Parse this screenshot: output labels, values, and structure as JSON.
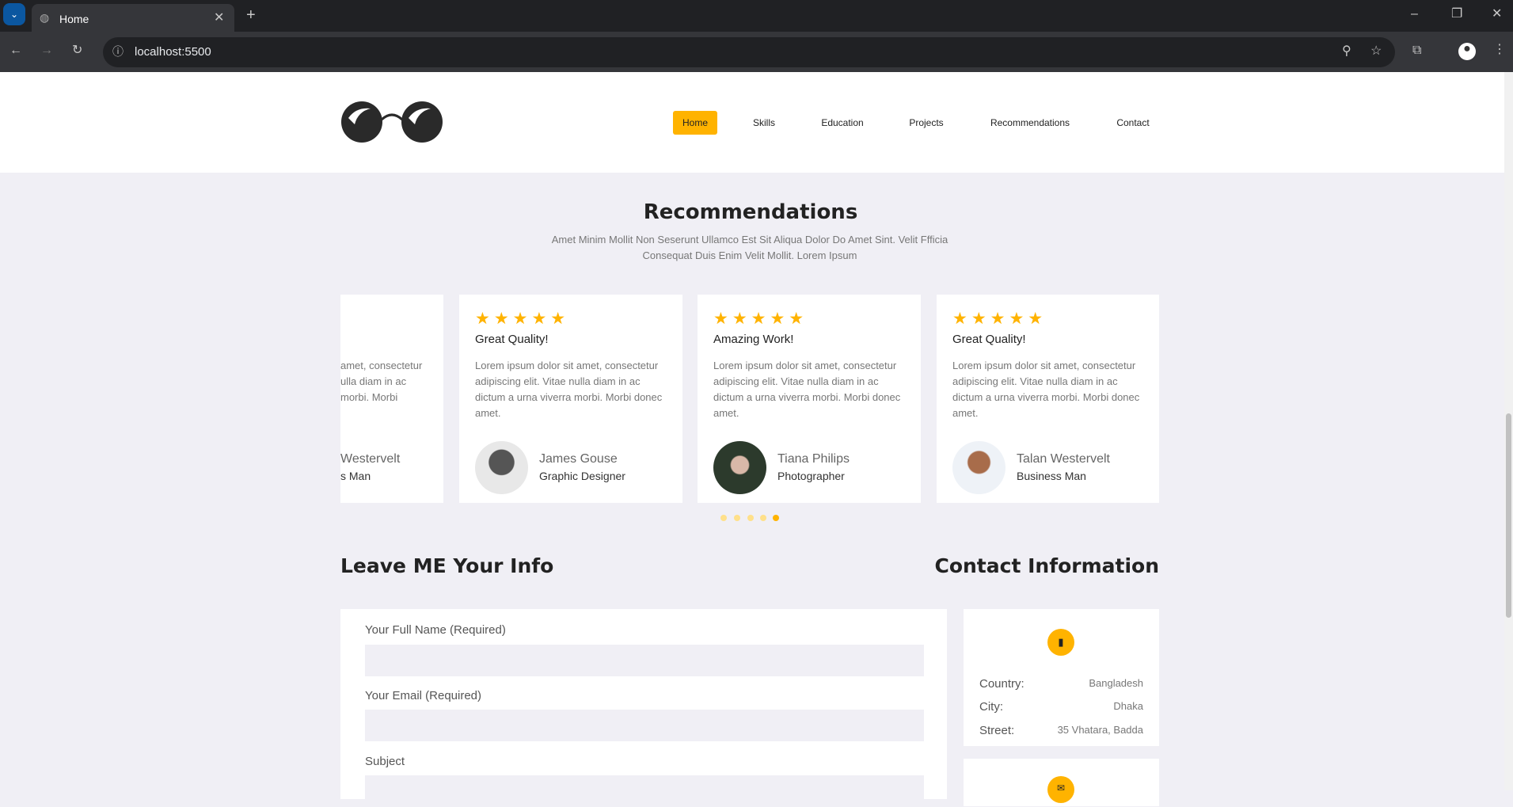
{
  "browser": {
    "tab_title": "Home",
    "url": "localhost:5500"
  },
  "nav": {
    "items": [
      {
        "label": "Home",
        "active": true
      },
      {
        "label": "Skills"
      },
      {
        "label": "Education"
      },
      {
        "label": "Projects"
      },
      {
        "label": "Recommendations"
      },
      {
        "label": "Contact"
      }
    ]
  },
  "recommendations": {
    "title": "Recommendations",
    "subtitle_line1": "Amet Minim Mollit Non Seserunt Ullamco Est Sit Aliqua Dolor Do Amet Sint. Velit Ffficia",
    "subtitle_line2": "Consequat Duis Enim Velit Mollit. Lorem Ipsum",
    "partial_card": {
      "text": "amet, consectetur\nulla diam in ac\nmorbi. Morbi",
      "name": "Westervelt",
      "role": "s Man"
    },
    "cards": [
      {
        "stars": "★★★★★",
        "rating": 5,
        "title": "Great Quality!",
        "text": "Lorem ipsum dolor sit amet, consectetur adipiscing elit. Vitae nulla diam in ac dictum a urna viverra morbi. Morbi donec amet.",
        "name": "James Gouse",
        "role": "Graphic Designer"
      },
      {
        "stars": "★★★★★",
        "rating": 5,
        "title": "Amazing Work!",
        "text": "Lorem ipsum dolor sit amet, consectetur adipiscing elit. Vitae nulla diam in ac dictum a urna viverra morbi. Morbi donec amet.",
        "name": "Tiana Philips",
        "role": "Photographer"
      },
      {
        "stars": "★★★★★",
        "rating": 5,
        "title": "Great Quality!",
        "text": "Lorem ipsum dolor sit amet, consectetur adipiscing elit. Vitae nulla diam in ac dictum a urna viverra morbi. Morbi donec amet.",
        "name": "Talan Westervelt",
        "role": "Business Man"
      }
    ],
    "carousel": {
      "pages": 5,
      "active": 5
    }
  },
  "form": {
    "title": "Leave ME Your Info",
    "fields": [
      {
        "label": "Your Full Name (Required)",
        "value": ""
      },
      {
        "label": "Your Email (Required)",
        "value": ""
      },
      {
        "label": "Subject",
        "value": ""
      }
    ]
  },
  "contact": {
    "title": "Contact Information",
    "address": {
      "icon": "map-icon",
      "rows": [
        {
          "label": "Country:",
          "value": "Bangladesh"
        },
        {
          "label": "City:",
          "value": "Dhaka"
        },
        {
          "label": "Street:",
          "value": "35 Vhatara, Badda"
        }
      ]
    },
    "mail": {
      "icon": "envelope-icon"
    }
  },
  "colors": {
    "accent": "#ffb300",
    "background": "#f0eff5"
  }
}
